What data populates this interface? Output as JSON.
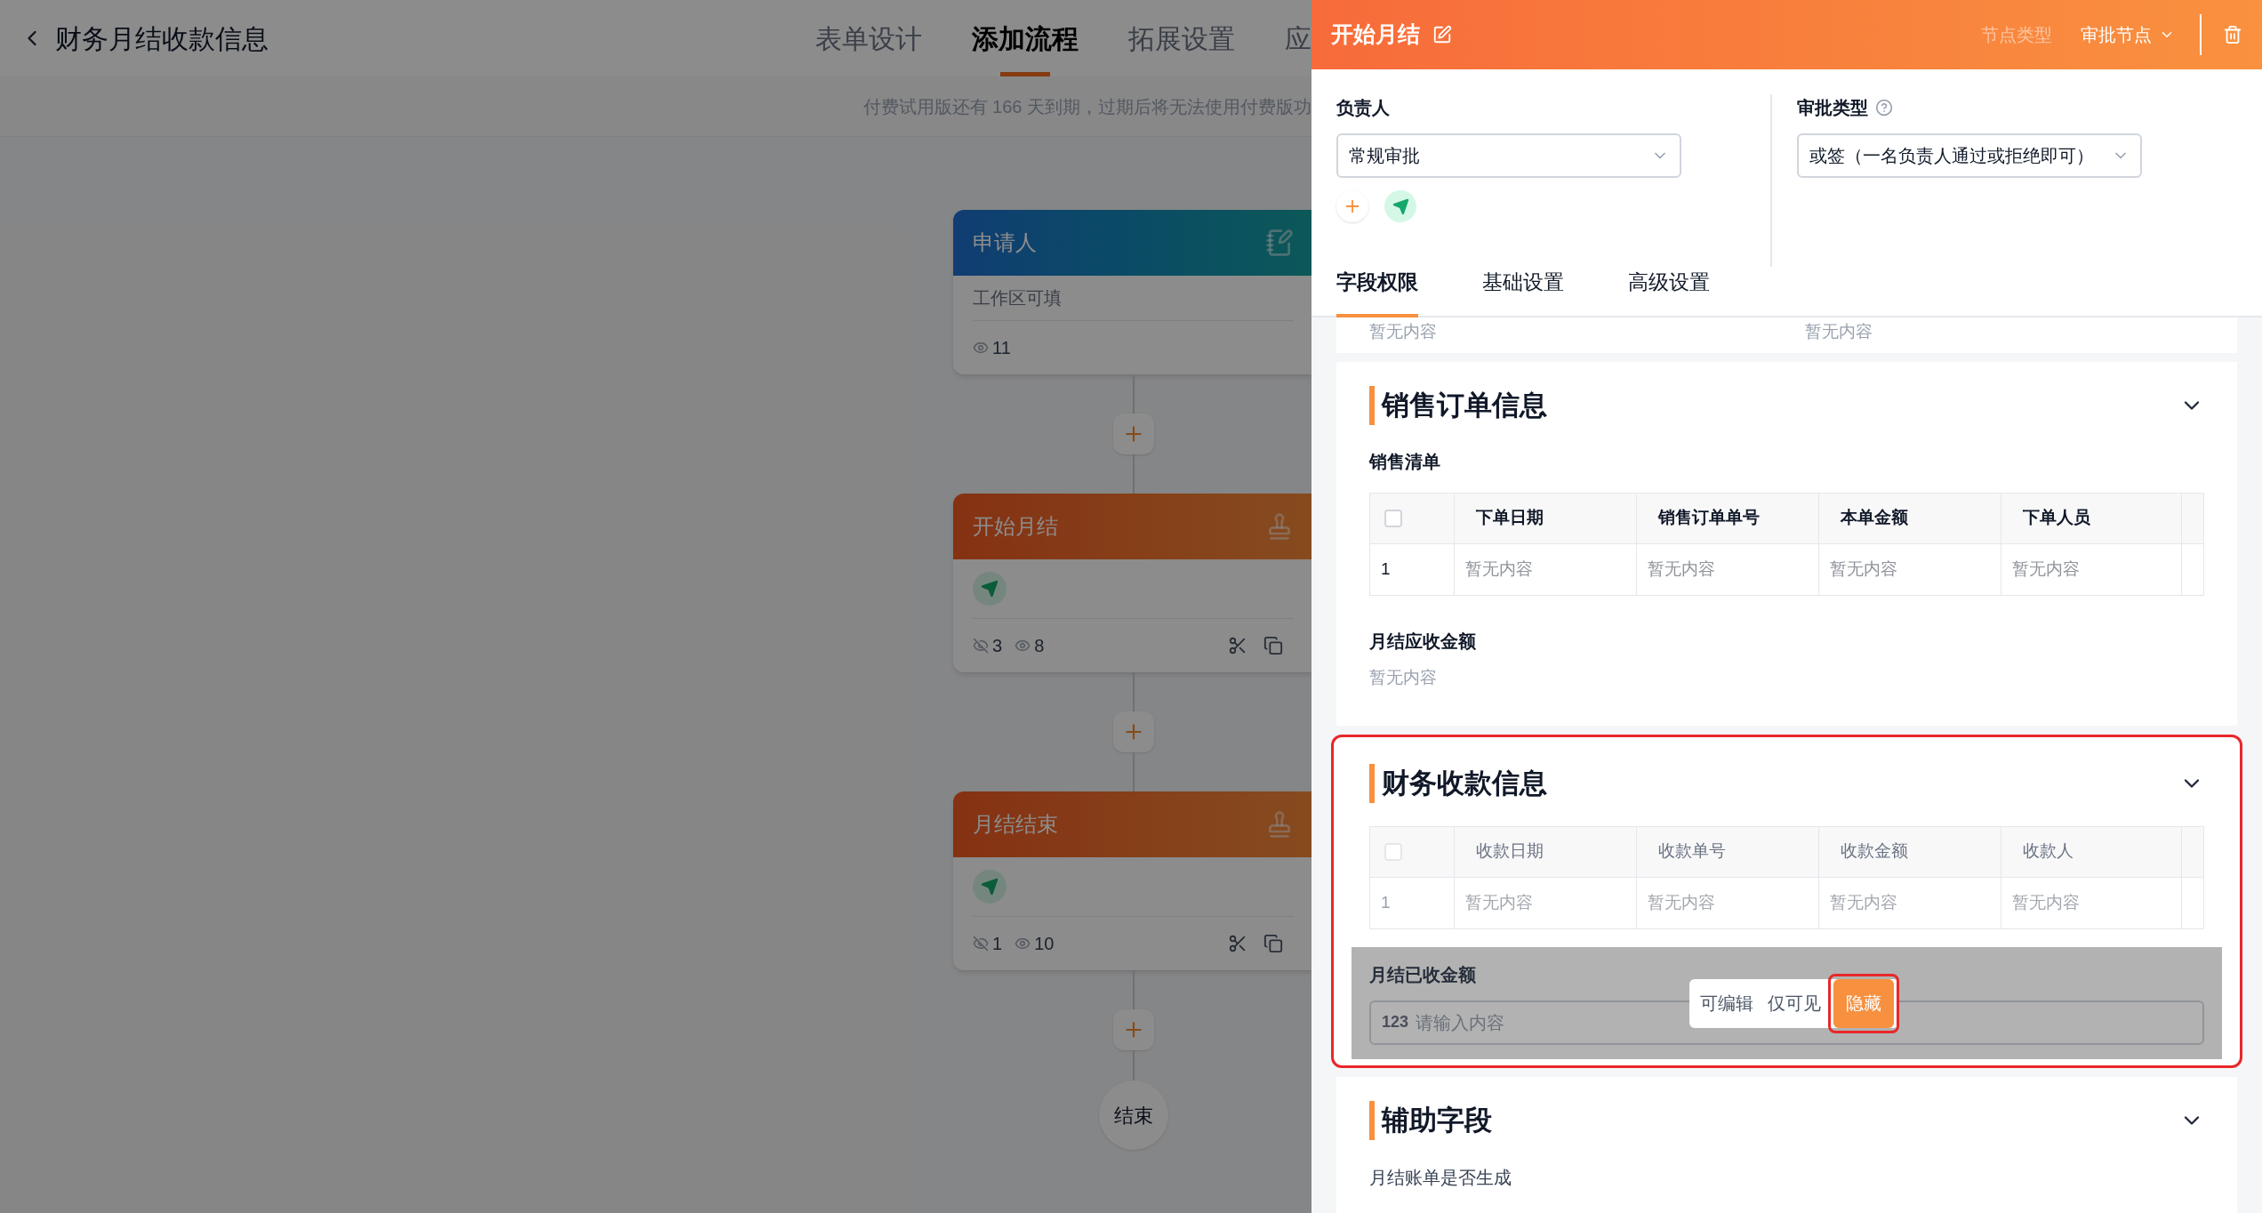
{
  "page": {
    "title": "财务月结收款信息",
    "tabs": [
      {
        "label": "表单设计",
        "selected": false
      },
      {
        "label": "添加流程",
        "selected": true
      },
      {
        "label": "拓展设置",
        "selected": false
      },
      {
        "label": "应",
        "selected": false
      }
    ],
    "notice": "付费试用版还有 166 天到期，过期后将无法使用付费版功"
  },
  "flow": {
    "nodes": [
      {
        "kind": "applicant",
        "title": "申请人",
        "note": "工作区可填",
        "visible_count": "11"
      },
      {
        "kind": "approver",
        "title": "开始月结",
        "hidden_count": "3",
        "visible_count": "8"
      },
      {
        "kind": "approver",
        "title": "月结结束",
        "hidden_count": "1",
        "visible_count": "10"
      }
    ],
    "end_label": "结束"
  },
  "panel": {
    "title": "开始月结",
    "node_type_label": "节点类型",
    "node_type": "审批节点",
    "assignee": {
      "label": "负责人",
      "value": "常规审批"
    },
    "approval_type": {
      "label": "审批类型",
      "value": "或签（一名负责人通过或拒绝即可）"
    },
    "tabs": [
      {
        "label": "字段权限",
        "selected": true
      },
      {
        "label": "基础设置",
        "selected": false
      },
      {
        "label": "高级设置",
        "selected": false
      }
    ],
    "sections": [
      {
        "kind": "partial",
        "cells": [
          "暂无内容",
          "暂无内容"
        ]
      },
      {
        "kind": "group",
        "title": "销售订单信息",
        "highlighted": false,
        "fields": [
          {
            "kind": "table",
            "label": "销售清单",
            "dimmed": false,
            "select_all_checked": false,
            "columns": [
              "",
              "下单日期",
              "销售订单单号",
              "本单金额",
              "下单人员"
            ],
            "rows": [
              [
                "1",
                "暂无内容",
                "暂无内容",
                "暂无内容",
                "暂无内容"
              ]
            ]
          },
          {
            "kind": "text",
            "label": "月结应收金额",
            "value": "暂无内容"
          }
        ]
      },
      {
        "kind": "group",
        "title": "财务收款信息",
        "highlighted": true,
        "fields": [
          {
            "kind": "table",
            "dimmed": true,
            "select_all_checked": false,
            "columns": [
              "",
              "收款日期",
              "收款单号",
              "收款金额",
              "收款人"
            ],
            "rows": [
              [
                "1",
                "暂无内容",
                "暂无内容",
                "暂无内容",
                "暂无内容"
              ]
            ]
          },
          {
            "kind": "input",
            "label": "月结已收金额",
            "icon": "123",
            "placeholder": "请输入内容",
            "hovered": true,
            "permissions": [
              {
                "label": "可编辑",
                "selected": false,
                "highlighted": false
              },
              {
                "label": "仅可见",
                "selected": false,
                "highlighted": false
              },
              {
                "label": "隐藏",
                "selected": true,
                "highlighted": true
              }
            ]
          }
        ]
      },
      {
        "kind": "group",
        "title": "辅助字段",
        "highlighted": false,
        "fields": [
          {
            "kind": "label",
            "label": "月结账单是否生成"
          }
        ]
      }
    ]
  }
}
